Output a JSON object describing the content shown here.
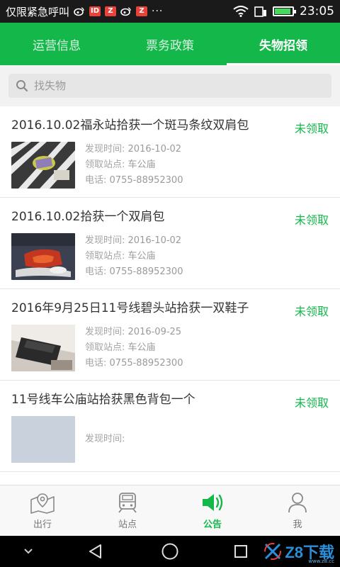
{
  "status_bar": {
    "carrier": "仅限紧急呼叫",
    "badges": [
      "ID",
      "Z",
      "Z"
    ],
    "more": "···",
    "time": "23:05",
    "battery_level": 0.9
  },
  "tabs": [
    {
      "label": "运营信息",
      "active": false
    },
    {
      "label": "票务政策",
      "active": false
    },
    {
      "label": "失物招领",
      "active": true
    }
  ],
  "search": {
    "placeholder": "找失物"
  },
  "meta_labels": {
    "found_time": "发现时间:",
    "station": "领取站点:",
    "phone": "电话:"
  },
  "items": [
    {
      "title": "2016.10.02福永站拾获一个斑马条纹双肩包",
      "status": "未领取",
      "found_time": "2016-10-02",
      "station": "车公庙",
      "phone": "0755-88952300",
      "thumb": "zebra-backpack"
    },
    {
      "title": "2016.10.02拾获一个双肩包",
      "status": "未领取",
      "found_time": "2016-10-02",
      "station": "车公庙",
      "phone": "0755-88952300",
      "thumb": "backpack"
    },
    {
      "title": "2016年9月25日11号线碧头站拾获一双鞋子",
      "status": "未领取",
      "found_time": "2016-09-25",
      "station": "车公庙",
      "phone": "0755-88952300",
      "thumb": "shoes"
    },
    {
      "title": "11号线车公庙站拾获黑色背包一个",
      "status": "未领取",
      "found_time": "",
      "station": "",
      "phone": "",
      "thumb": "partial"
    }
  ],
  "bottom_nav": [
    {
      "label": "出行",
      "icon": "map-pin-icon",
      "active": false
    },
    {
      "label": "站点",
      "icon": "train-icon",
      "active": false
    },
    {
      "label": "公告",
      "icon": "speaker-icon",
      "active": true
    },
    {
      "label": "我",
      "icon": "person-icon",
      "active": false
    }
  ],
  "watermark": {
    "text": "Z8下载",
    "sub": "www.z8.cc"
  },
  "colors": {
    "accent": "#14b84a",
    "status_green": "#14b84a"
  }
}
